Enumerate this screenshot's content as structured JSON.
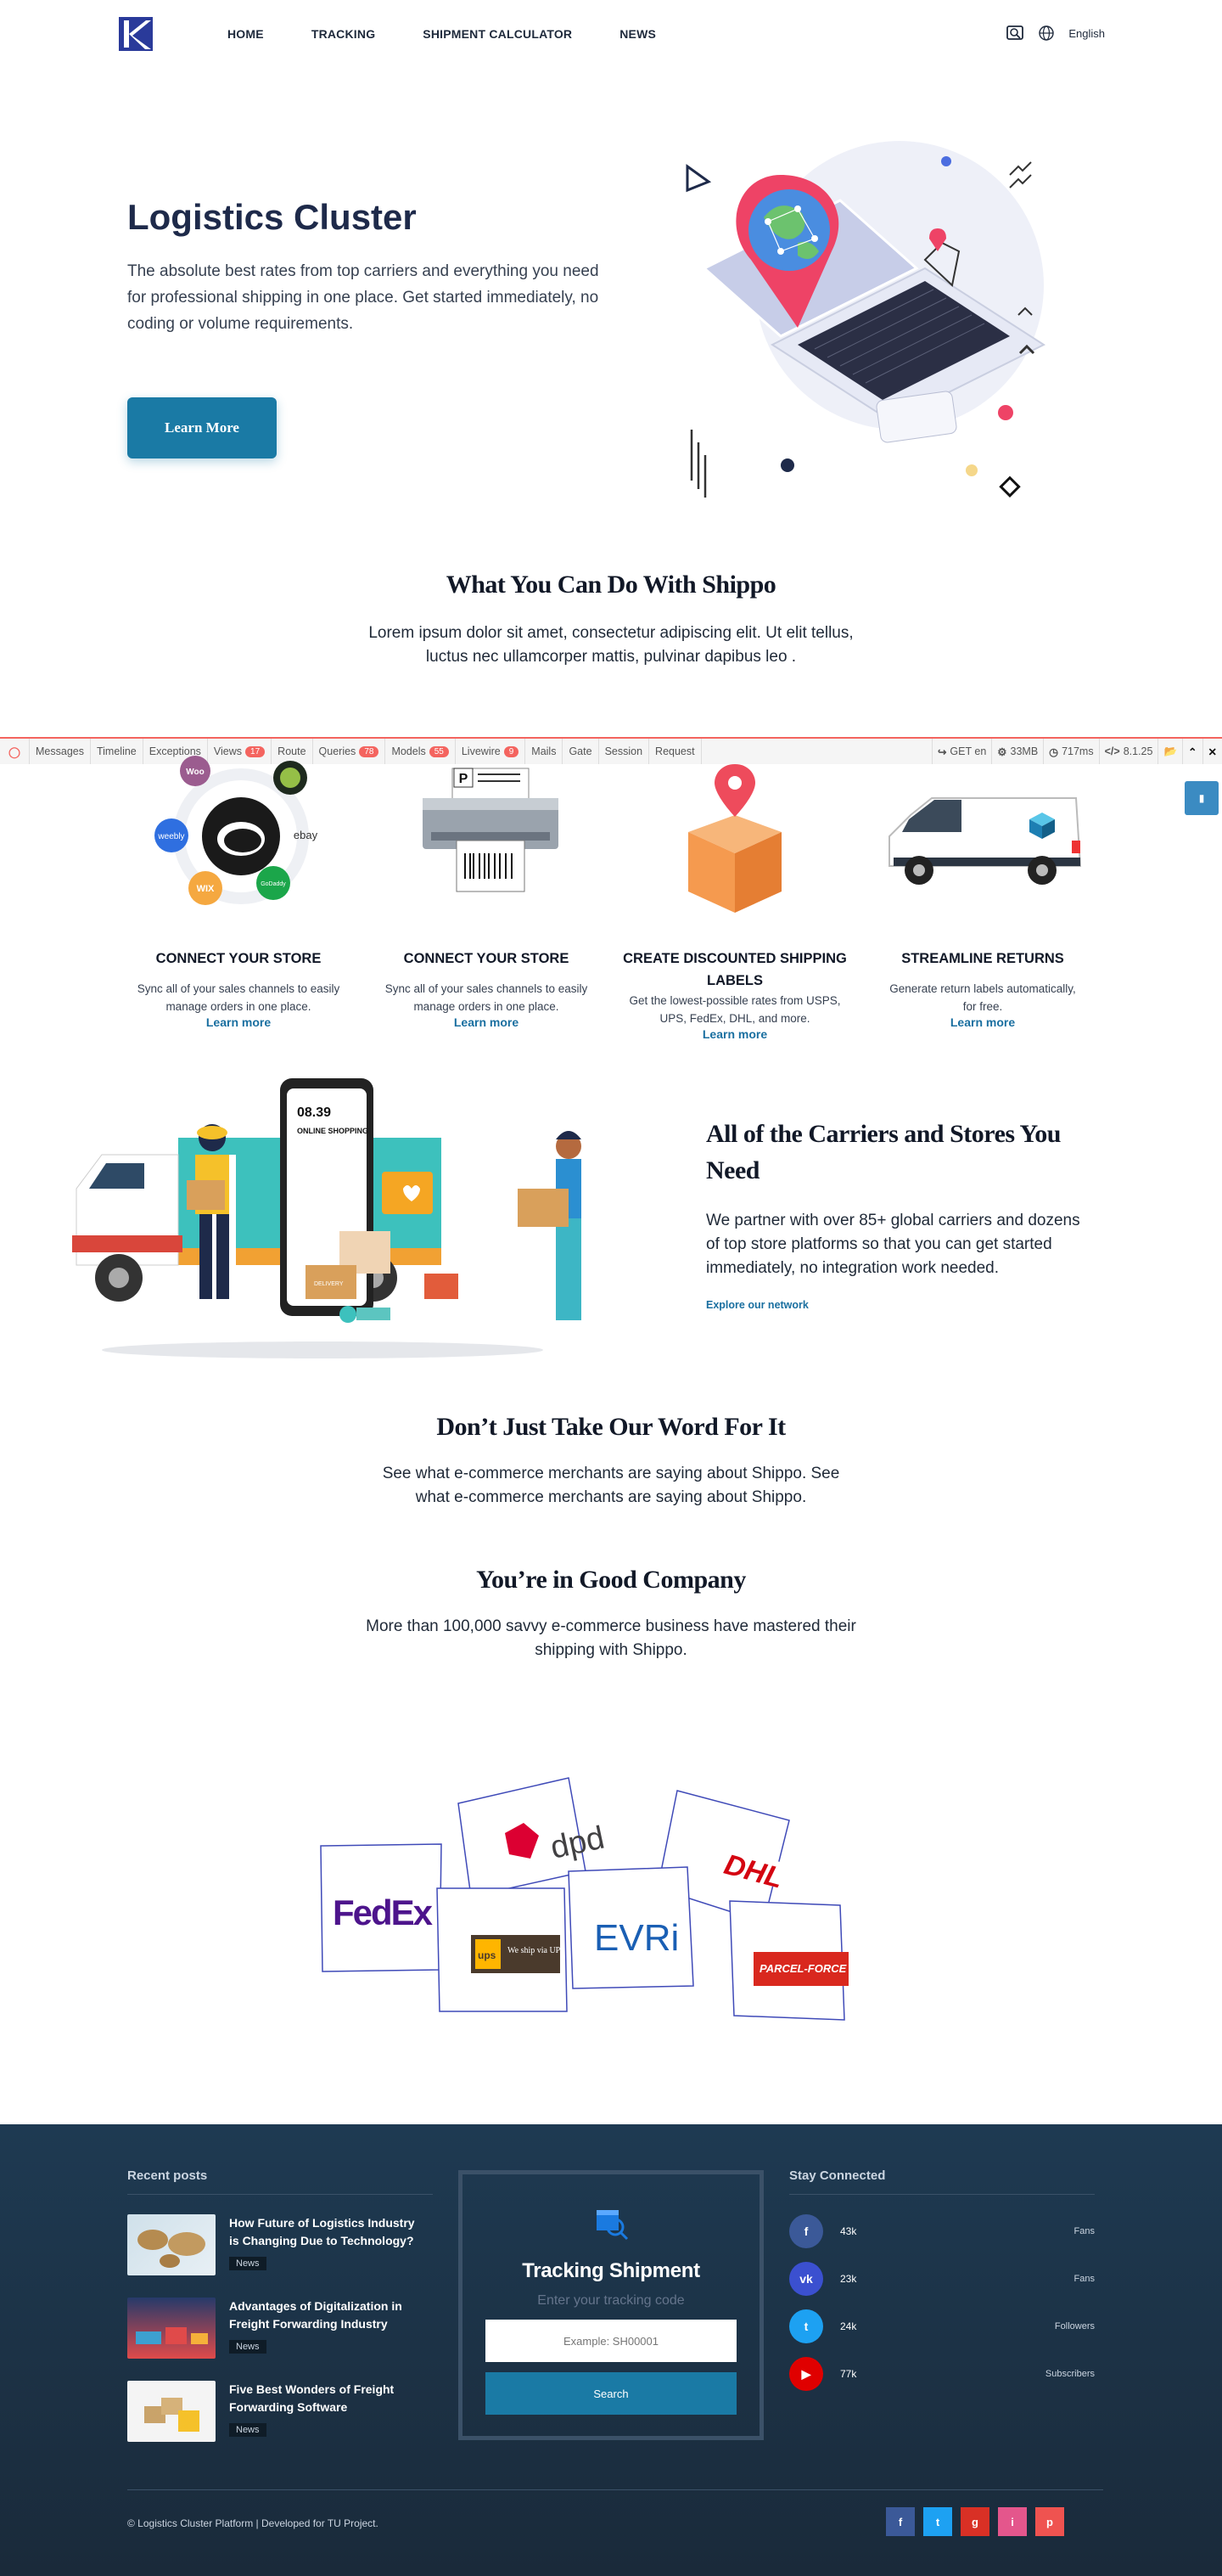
{
  "nav": {
    "items": [
      "HOME",
      "TRACKING",
      "SHIPMENT CALCULATOR",
      "NEWS"
    ],
    "language": "English"
  },
  "hero": {
    "title": "Logistics Cluster",
    "text": "The absolute best rates from top carriers and everything you need for professional shipping in one place. Get started immediately, no coding or volume requirements.",
    "button": "Learn More"
  },
  "what": {
    "title": "What You Can Do With Shippo",
    "text": "Lorem ipsum dolor sit amet, consectetur adipiscing elit. Ut elit tellus, luctus nec ullamcorper mattis, pulvinar dapibus leo ."
  },
  "debugbar": {
    "tabs": [
      {
        "label": "Messages",
        "badge": ""
      },
      {
        "label": "Timeline",
        "badge": ""
      },
      {
        "label": "Exceptions",
        "badge": ""
      },
      {
        "label": "Views",
        "badge": "17"
      },
      {
        "label": "Route",
        "badge": ""
      },
      {
        "label": "Queries",
        "badge": "78"
      },
      {
        "label": "Models",
        "badge": "55"
      },
      {
        "label": "Livewire",
        "badge": "9"
      },
      {
        "label": "Mails",
        "badge": ""
      },
      {
        "label": "Gate",
        "badge": ""
      },
      {
        "label": "Session",
        "badge": ""
      },
      {
        "label": "Request",
        "badge": ""
      }
    ],
    "method": "GET en",
    "memory": "33MB",
    "time": "717ms",
    "version": "8.1.25"
  },
  "features": [
    {
      "title": "CONNECT YOUR STORE",
      "desc": "Sync all of your sales channels to easily manage orders in one place.",
      "link": "Learn more",
      "store_labels": [
        "weebly",
        "ebay",
        "WIX",
        "GoDaddy"
      ]
    },
    {
      "title": "CONNECT YOUR STORE",
      "desc": "Sync all of your sales channels to easily manage orders in one place.",
      "link": "Learn more",
      "printer_label": "P"
    },
    {
      "title": "CREATE DISCOUNTED SHIPPING LABELS",
      "desc": "Get the lowest-possible rates from USPS, UPS, FedEx, DHL, and more.",
      "link": "Learn more"
    },
    {
      "title": "STREAMLINE RETURNS",
      "desc": "Generate return labels automatically, for free.",
      "link": "Learn more"
    }
  ],
  "carriers": {
    "title": "All of the Carriers and Stores You Need",
    "text": "We partner with over 85+ global carriers and dozens of top store platforms so that you can get started immediately, no integration work needed.",
    "link": "Explore our network",
    "phone_time": "08.39",
    "phone_label": "ONLINE SHOPPING",
    "box_label": "DELIVERY"
  },
  "testimonials": {
    "title": "Don’t Just Take Our Word For It",
    "text": "See what e-commerce merchants are saying about Shippo. See what e-commerce merchants are saying about Shippo."
  },
  "company": {
    "title": "You’re in Good Company",
    "text": "More than 100,000 savvy e-commerce business have mastered their shipping with Shippo.",
    "logos": {
      "fedex": "FedEx",
      "dpd": "dpd",
      "dhl": "DHL",
      "ups": "ups",
      "ups_text": "We ship via UPS",
      "evri": "EVRi",
      "parcel": "PARCEL-FORCE"
    }
  },
  "footer": {
    "recent_posts": "Recent posts",
    "posts": [
      {
        "title": "How Future of Logistics Industry is Changing Due to Technology?",
        "tag": "News"
      },
      {
        "title": "Advantages of Digitalization in Freight Forwarding Industry",
        "tag": "News"
      },
      {
        "title": "Five Best Wonders of Freight Forwarding Software",
        "tag": "News"
      }
    ],
    "tracking": {
      "title": "Tracking Shipment",
      "subtitle": "Enter your tracking code",
      "placeholder": "Example: SH00001",
      "button": "Search"
    },
    "stay_connected": "Stay Connected",
    "social": [
      {
        "icon": "facebook-icon",
        "count": "43k",
        "label": "Fans",
        "color": "#3b5998"
      },
      {
        "icon": "vk-icon",
        "count": "23k",
        "label": "Fans",
        "color": "#3b50d0"
      },
      {
        "icon": "twitter-icon",
        "count": "24k",
        "label": "Followers",
        "color": "#1da1f2"
      },
      {
        "icon": "youtube-icon",
        "count": "77k",
        "label": "Subscribers",
        "color": "#e00000"
      }
    ],
    "copyright": "© Logistics Cluster Platform | Developed for TU Project."
  }
}
